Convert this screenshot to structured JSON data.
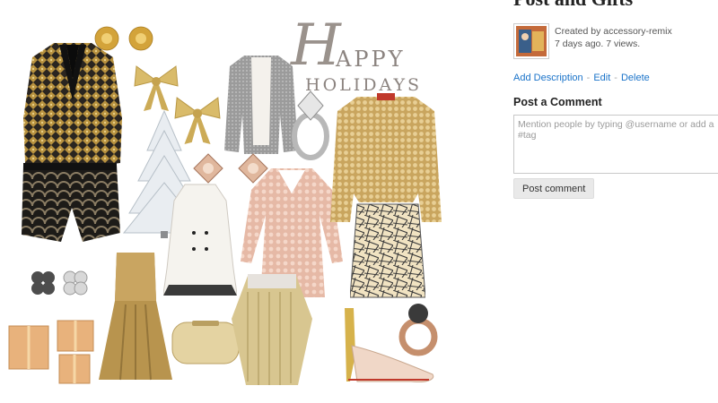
{
  "collage": {
    "greeting": {
      "initial": "H",
      "line1": "APPY",
      "line2": "HOLIDAYS"
    }
  },
  "panel": {
    "set_title": "Post and Gifts",
    "creator_text": "Created by accessory-remix",
    "time_views": "7 days ago. 7 views.",
    "actions": {
      "add_description": "Add Description",
      "edit": "Edit",
      "delete": "Delete",
      "separator": "-"
    },
    "comment_heading": "Post a Comment",
    "comment_placeholder": "Mention people by typing @username or add a #tag",
    "post_button": "Post comment"
  },
  "colors": {
    "link": "#1a73c9",
    "gold": "#c9a24a",
    "rose_gold": "#e2b9a4",
    "silver": "#a8a8a8"
  }
}
